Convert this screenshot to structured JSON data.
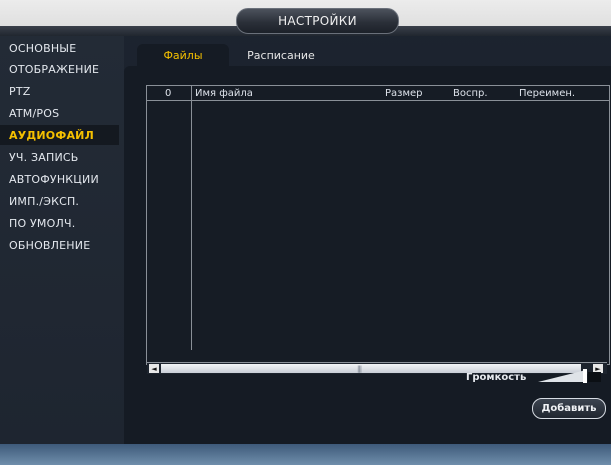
{
  "window": {
    "title": "НАСТРОЙКИ"
  },
  "menu": {
    "items": [
      {
        "label": "ОСНОВНЫЕ",
        "active": false
      },
      {
        "label": "ОТОБРАЖЕНИЕ",
        "active": false
      },
      {
        "label": "PTZ",
        "active": false
      },
      {
        "label": "ATM/POS",
        "active": false
      },
      {
        "label": "АУДИОФАЙЛ",
        "active": true
      },
      {
        "label": "УЧ. ЗАПИСЬ",
        "active": false
      },
      {
        "label": "АВТОФУНКЦИИ",
        "active": false
      },
      {
        "label": "ИМП./ЭКСП.",
        "active": false
      },
      {
        "label": "ПО УМОЛЧ.",
        "active": false
      },
      {
        "label": "ОБНОВЛЕНИЕ",
        "active": false
      }
    ]
  },
  "tabs": [
    {
      "label": "Файлы",
      "active": true
    },
    {
      "label": "Расписание",
      "active": false
    }
  ],
  "table": {
    "count": "0",
    "columns": {
      "filename": "Имя файла",
      "size": "Размер",
      "play": "Воспр.",
      "rename": "Переимен."
    },
    "rows": []
  },
  "scrollbar": {
    "left_arrow": "◄",
    "right_arrow": "►",
    "grip": "|||"
  },
  "volume": {
    "label": "Громкость",
    "level": 0.85
  },
  "buttons": {
    "add": "Добавить"
  },
  "colors": {
    "accent": "#f5c000",
    "background": "#1a212c",
    "text": "#e4e8ee"
  },
  "icons": {
    "left_arrow": "scroll-left-arrow-icon",
    "right_arrow": "scroll-right-arrow-icon",
    "volume": "volume-wedge-icon"
  }
}
